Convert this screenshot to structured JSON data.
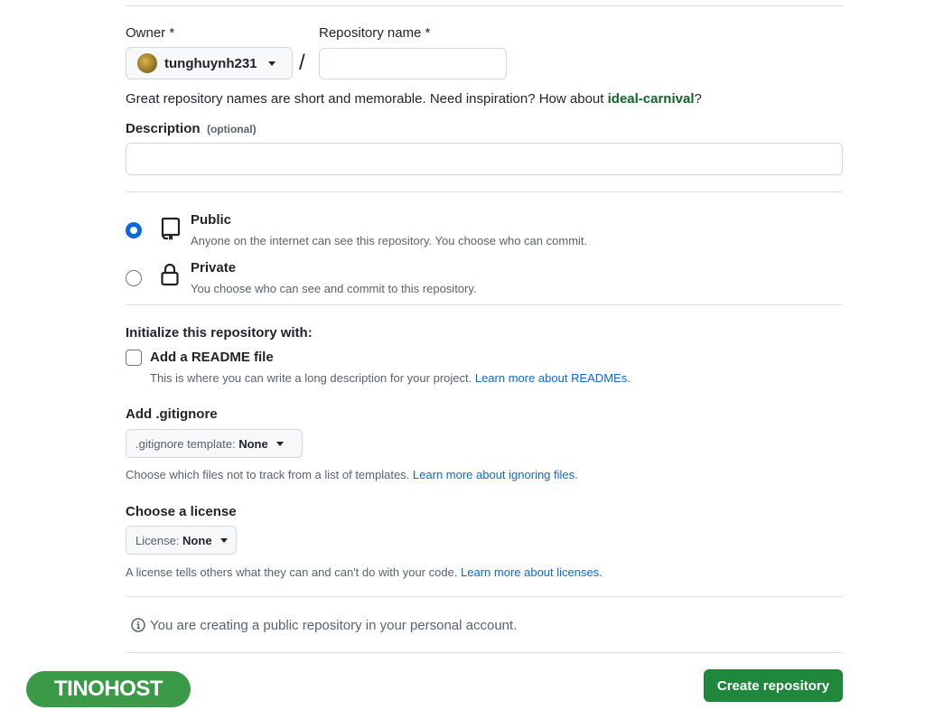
{
  "owner": {
    "label": "Owner *",
    "value": "tunghuynh231"
  },
  "repo_name": {
    "label": "Repository name *",
    "value": "",
    "separator": "/"
  },
  "suggestion": {
    "text": "Great repository names are short and memorable. Need inspiration? How about ",
    "name": "ideal-carnival",
    "end": "?"
  },
  "description": {
    "label": "Description",
    "optional": "(optional)",
    "value": ""
  },
  "visibility": {
    "selected": "public",
    "public_title": "Public",
    "public_desc": "Anyone on the internet can see this repository. You choose who can commit.",
    "private_title": "Private",
    "private_desc": "You choose who can see and commit to this repository."
  },
  "init": {
    "heading": "Initialize this repository with:",
    "readme_label": "Add a README file",
    "readme_checked": false,
    "readme_desc": "This is where you can write a long description for your project. ",
    "readme_link": "Learn more about READMEs."
  },
  "gitignore": {
    "heading": "Add .gitignore",
    "button_prefix": ".gitignore template: ",
    "button_value": "None",
    "desc": "Choose which files not to track from a list of templates. ",
    "link": "Learn more about ignoring files."
  },
  "license": {
    "heading": "Choose a license",
    "button_prefix": "License: ",
    "button_value": "None",
    "desc": "A license tells others what they can and can't do with your code. ",
    "link": "Learn more about licenses."
  },
  "notice": {
    "text": "You are creating a public repository in your personal account."
  },
  "submit": {
    "label": "Create repository"
  },
  "watermark": {
    "text": "TINOHOST"
  },
  "colors": {
    "accent": "#0969da",
    "green": "#1f883d",
    "suggest_green": "#116329",
    "watermark_green": "#3a9a48"
  }
}
